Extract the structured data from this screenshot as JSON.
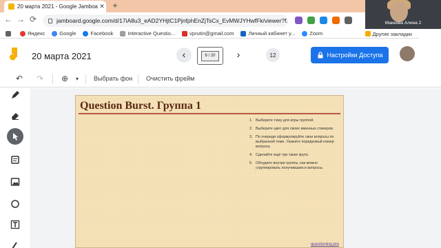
{
  "browser": {
    "tab_title": "20 марта 2021 - Google Jamboa",
    "tab_close": "✕",
    "new_tab": "+",
    "url": "jamboard.google.com/d/17iA8u3_eAD2YHjtC1PjnfphEnZjTsCx_EvMWJYHwfFk/viewer?f...",
    "nav": {
      "back": "←",
      "forward": "→",
      "reload": "⟳"
    }
  },
  "bookmarks": {
    "items": [
      {
        "label": "Приложения",
        "icon": "apps-icon",
        "color": "#5f6368"
      },
      {
        "label": "Яндекс",
        "icon": "yandex-icon",
        "color": "#e53935"
      },
      {
        "label": "Google",
        "icon": "google-icon",
        "color": "#4285f4"
      },
      {
        "label": "Facebook",
        "icon": "facebook-icon",
        "color": "#1877f2"
      },
      {
        "label": "Interactive Questio...",
        "icon": "page-icon",
        "color": "#9e9e9e"
      },
      {
        "label": "vprutin@gmail.com",
        "icon": "gmail-icon",
        "color": "#d93025"
      },
      {
        "label": "Личный кабинет у...",
        "icon": "bookmark-icon",
        "color": "#1565c0"
      },
      {
        "label": "Zoom",
        "icon": "zoom-icon",
        "color": "#2d8cff"
      }
    ],
    "other": "Другие закладки"
  },
  "webcam": {
    "name": "Макеева Алина 2"
  },
  "header": {
    "title": "20 марта 2021",
    "frame_label": "6 / 20",
    "frame_count": "12",
    "share_label": "Настройки Доступа",
    "prev": "‹",
    "next": "›"
  },
  "toolbar": {
    "undo": "↶",
    "redo": "↷",
    "zoom_icon": "⊕",
    "zoom_caret": "▾",
    "background_label": "Выбрать фон",
    "clear_label": "Очистить фрейм"
  },
  "palette": [
    "pen-icon",
    "eraser-icon",
    "select-icon",
    "sticky-note-icon",
    "image-icon",
    "circle-icon",
    "text-box-icon"
  ],
  "slide": {
    "title": "Question Burst. Группа 1",
    "steps": [
      {
        "num": "1.",
        "text": "Выберите тему для игры группой."
      },
      {
        "num": "2.",
        "text": "Выберите цвет для своих именных стикеров."
      },
      {
        "num": "3.",
        "text": "По очереди сформулируйте свои вопросы по выбранной теме. Укажите порядковый номер вопроса."
      },
      {
        "num": "4.",
        "text": "Сделайте ещё три таких круга."
      },
      {
        "num": "5.",
        "text": "Обсудите внутри группы, как можно сгруппировать получившиеся вопросы."
      }
    ],
    "link": "questioning.pro"
  },
  "colors": {
    "accent": "#1a73e8",
    "tabstrip": "#f3c6a8",
    "slide_title": "#5a2616",
    "slide_rule": "#b85a45",
    "slide_bg": "#f6e3b9"
  }
}
